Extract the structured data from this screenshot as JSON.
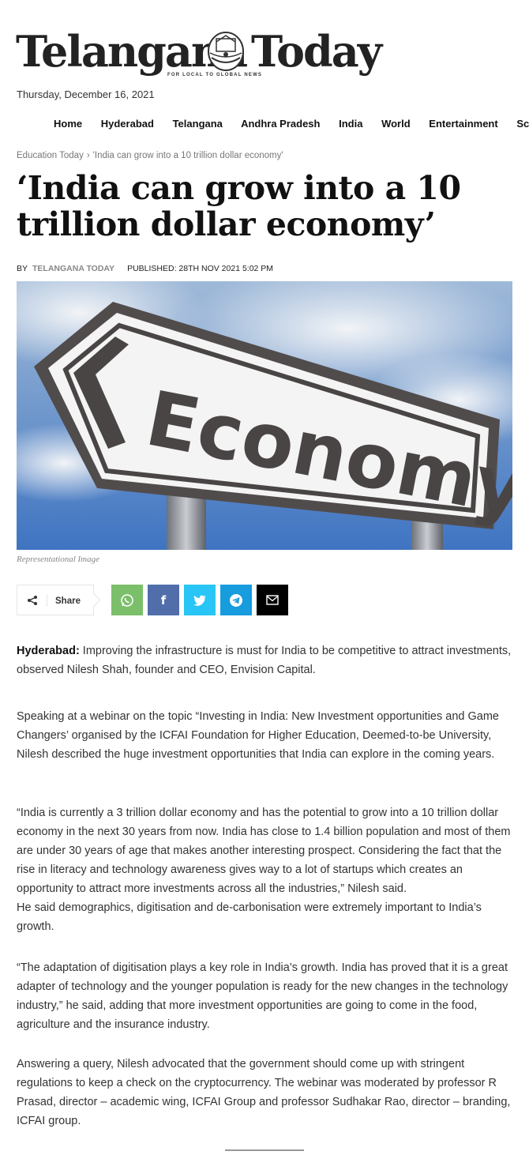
{
  "site": {
    "logo_left": "Telangana",
    "logo_right": "Today",
    "tagline": "FOR LOCAL TO GLOBAL NEWS",
    "date": "Thursday, December 16, 2021"
  },
  "nav": {
    "items": [
      "Home",
      "Hyderabad",
      "Telangana",
      "Andhra Pradesh",
      "India",
      "World",
      "Entertainment",
      "Sci"
    ]
  },
  "breadcrumb": {
    "section": "Education Today",
    "separator": "›",
    "current": "'India can grow into a 10 trillion dollar economy'"
  },
  "article": {
    "title": "‘India can grow into a 10 trillion dollar economy’",
    "by_label": "BY",
    "author": "TELANGANA TODAY",
    "published": "PUBLISHED: 28TH NOV 2021 5:02 PM",
    "image_sign_text": "Economy",
    "image_caption": "Representational Image",
    "share_label": "Share",
    "lead_bold": "Hyderabad:",
    "lead_text": " Improving the infrastructure is must for India to be competitive to attract investments, observed Nilesh Shah, founder and CEO, Envision Capital.",
    "paragraphs": [
      "Speaking at a webinar on the topic “Investing in India: New Investment opportunities and Game Changers’ organised by the ICFAI Foundation for Higher Education, Deemed-to-be University, Nilesh described the huge investment opportunities that India can explore in the coming years.",
      "“India is currently a 3 trillion dollar economy and has the potential to grow into a 10 trillion dollar economy in the next 30 years from now. India has close to 1.4 billion population and most of them are under 30 years of age that makes another interesting prospect. Considering the fact that the rise in literacy and technology awareness gives way to a lot of startups which creates an opportunity to attract more investments across all the industries,” Nilesh said.",
      "He said demographics, digitisation and de-carbonisation were extremely important to India’s growth.",
      "“The adaptation of digitisation plays a key role in India’s growth. India has proved that it is a great adapter of technology and the younger population is ready for the new changes in the technology industry,” he said, adding that more investment opportunities are going to come in the food, agriculture and the insurance industry.",
      "Answering a query, Nilesh advocated that the government should come up with stringent regulations to keep a check on the cryptocurrency. The webinar was moderated by professor R Prasad, director – academic wing, ICFAI Group and professor Sudhakar Rao, director – branding, ICFAI group."
    ]
  },
  "share_buttons": [
    {
      "name": "whatsapp",
      "color": "#7bbf6a"
    },
    {
      "name": "facebook",
      "color": "#516eab"
    },
    {
      "name": "twitter",
      "color": "#29c5f6"
    },
    {
      "name": "telegram",
      "color": "#179cde"
    },
    {
      "name": "email",
      "color": "#000000"
    }
  ]
}
